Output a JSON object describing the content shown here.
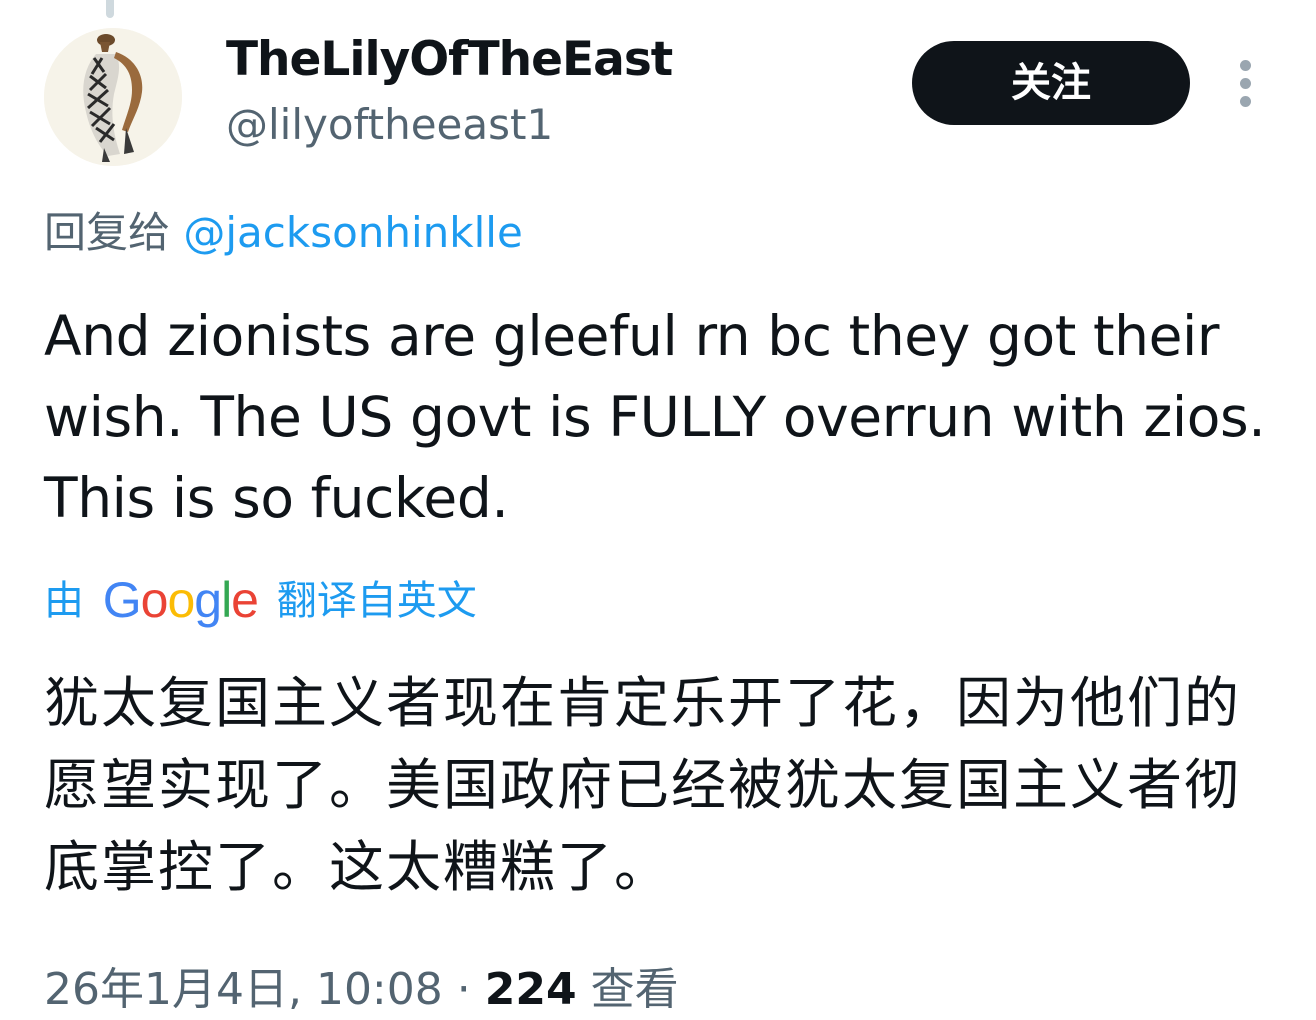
{
  "tweet": {
    "author": {
      "display_name": "TheLilyOfTheEast",
      "handle": "@lilyoftheeast1",
      "avatar_icon": "avatar-image"
    },
    "follow_label": "关注",
    "more_icon": "more-options-icon",
    "reply": {
      "prefix": "回复给",
      "target": "@jacksonhinklle"
    },
    "text": "And zionists are gleeful rn bc they got their wish. The US govt is FULLY overrun with zios. This is so fucked.",
    "translation": {
      "by": "由",
      "logo_text": "Google",
      "suffix": "翻译自英文",
      "text": "犹太复国主义者现在肯定乐开了花，因为他们的愿望实现了。美国政府已经被犹太复国主义者彻底掌控了。这太糟糕了。"
    },
    "meta": {
      "timestamp": "26年1月4日, 10:08",
      "separator": "·",
      "views": "224",
      "views_label": "查看"
    }
  },
  "colors": {
    "primary_text": "#0f1419",
    "secondary_text": "#536471",
    "link": "#1d9bf0",
    "follow_bg": "#0f1419"
  }
}
